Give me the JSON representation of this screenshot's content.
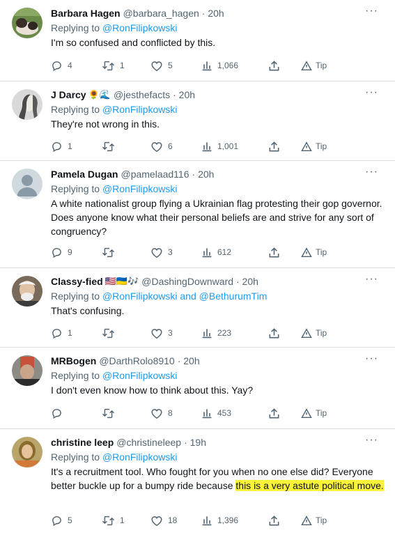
{
  "colors": {
    "link": "#1d9bf0",
    "secondary": "#536471",
    "highlight": "#fbf33a"
  },
  "tweets": [
    {
      "name": "Barbara Hagen",
      "emoji": "",
      "handle": "@barbara_hagen",
      "time": "· 20h",
      "reply_prefix": "Replying to",
      "reply_to": "@RonFilipkowski",
      "text": "I'm so confused and conflicted by this.",
      "text_highlight": "",
      "stats": {
        "replies": "4",
        "retweets": "1",
        "likes": "5",
        "views": "1,066",
        "tip": "Tip"
      }
    },
    {
      "name": "J Darcy",
      "emoji": "🌻🌊",
      "handle": "@jesthefacts",
      "time": "· 20h",
      "reply_prefix": "Replying to",
      "reply_to": "@RonFilipkowski",
      "text": "They're not wrong in this.",
      "text_highlight": "",
      "stats": {
        "replies": "1",
        "retweets": "",
        "likes": "6",
        "views": "1,001",
        "tip": "Tip"
      }
    },
    {
      "name": "Pamela Dugan",
      "emoji": "",
      "handle": "@pamelaad116",
      "time": "· 20h",
      "reply_prefix": "Replying to",
      "reply_to": "@RonFilipkowski",
      "text": "A white nationalist group flying a Ukrainian flag protesting their gop governor. Does anyone know what their personal beliefs are and strive for any sort of congruency?",
      "text_highlight": "",
      "stats": {
        "replies": "9",
        "retweets": "",
        "likes": "3",
        "views": "612",
        "tip": "Tip"
      }
    },
    {
      "name": "Classy-fied",
      "emoji": "🇺🇸🇺🇦🎶",
      "handle": "@DashingDownward",
      "time": "· 20h",
      "reply_prefix": "Replying to",
      "reply_to": "@RonFilipkowski and @BethurumTim",
      "text": "That's confusing.",
      "text_highlight": "",
      "stats": {
        "replies": "1",
        "retweets": "",
        "likes": "3",
        "views": "223",
        "tip": "Tip"
      }
    },
    {
      "name": "MRBogen",
      "emoji": "",
      "handle": "@DarthRolo8910",
      "time": "· 20h",
      "reply_prefix": "Replying to",
      "reply_to": "@RonFilipkowski",
      "text": "I don't even know how to think about this. Yay?",
      "text_highlight": "",
      "stats": {
        "replies": "",
        "retweets": "",
        "likes": "8",
        "views": "453",
        "tip": "Tip"
      }
    },
    {
      "name": "christine leep",
      "emoji": "",
      "handle": "@christineleep",
      "time": "· 19h",
      "reply_prefix": "Replying to",
      "reply_to": "@RonFilipkowski",
      "text": "It's a recruitment tool.  Who fought for you when no one else did? Everyone better buckle up for a bumpy ride because ",
      "text_highlight": "this is a very astute political move.",
      "stats": {
        "replies": "5",
        "retweets": "1",
        "likes": "18",
        "views": "1,396",
        "tip": "Tip"
      }
    }
  ],
  "more_label": "···"
}
